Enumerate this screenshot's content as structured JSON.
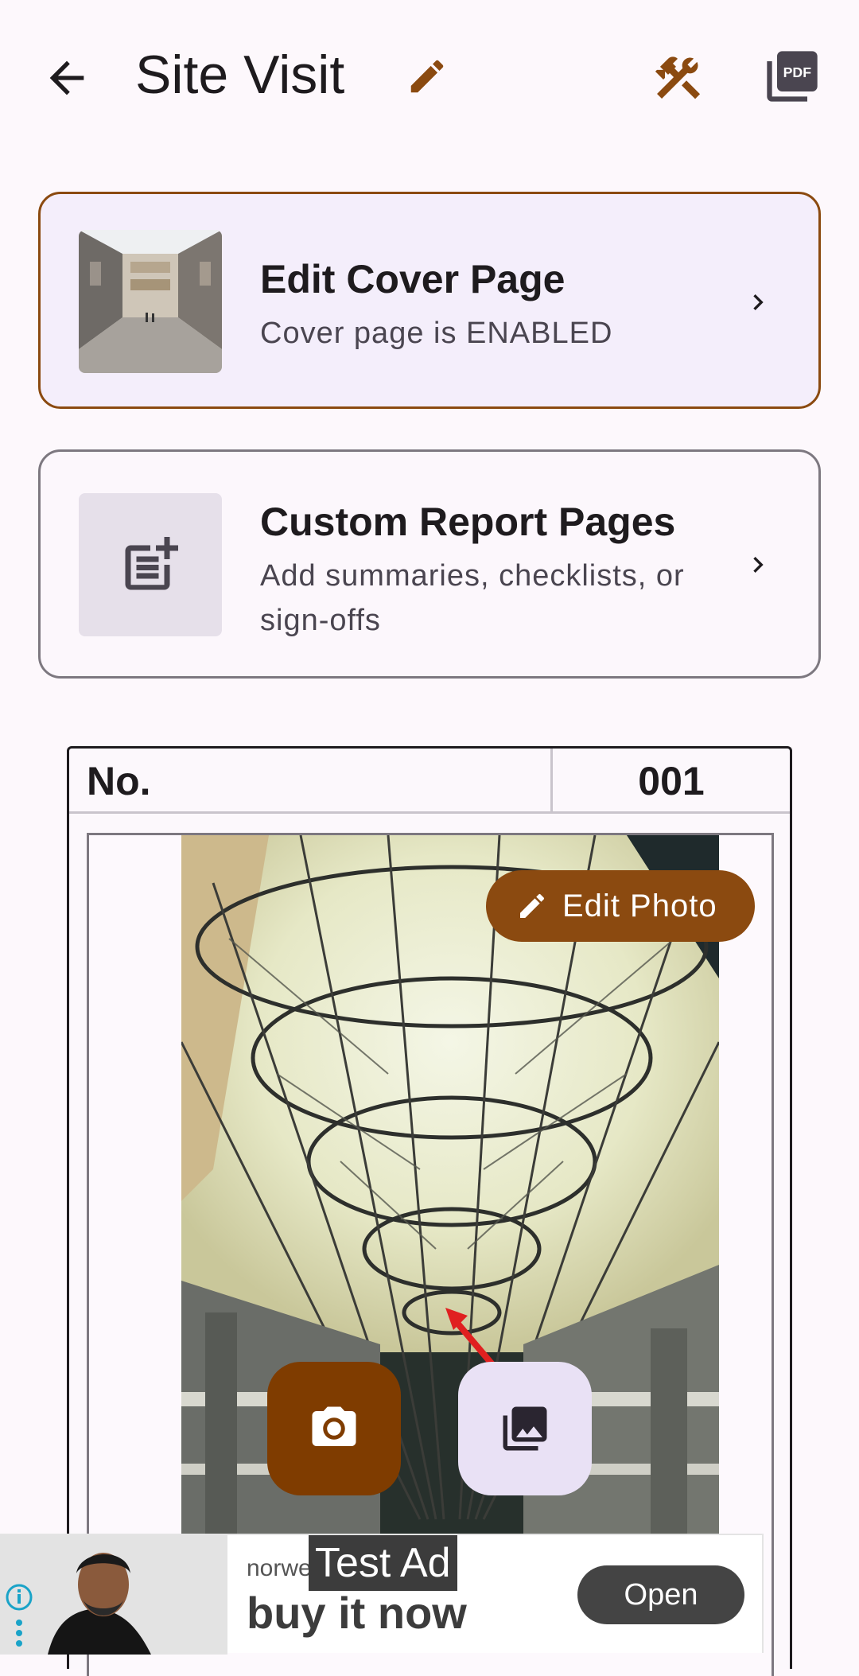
{
  "app_bar": {
    "title": "Site Visit",
    "icons": {
      "back": "arrow-back-icon",
      "edit": "pencil-icon",
      "tools": "hammer-wrench-icon",
      "pdf": "pdf-icon"
    },
    "accent_color": "#8b4a10"
  },
  "cover_card": {
    "title": "Edit Cover Page",
    "subtitle": "Cover page is ENABLED",
    "icon": "chevron-right-icon"
  },
  "custom_card": {
    "title": "Custom Report Pages",
    "subtitle": "Add summaries, checklists, or sign-offs",
    "icon": "post-add-icon"
  },
  "photo_page": {
    "number_label": "No.",
    "number_value": "001",
    "edit_photo_label": "Edit Photo",
    "camera_icon": "camera-icon",
    "gallery_icon": "photo-library-icon"
  },
  "ad": {
    "badge": "Test Ad",
    "brand": "norwe",
    "headline": "buy it now",
    "cta": "Open",
    "info_icon": "info-icon"
  }
}
